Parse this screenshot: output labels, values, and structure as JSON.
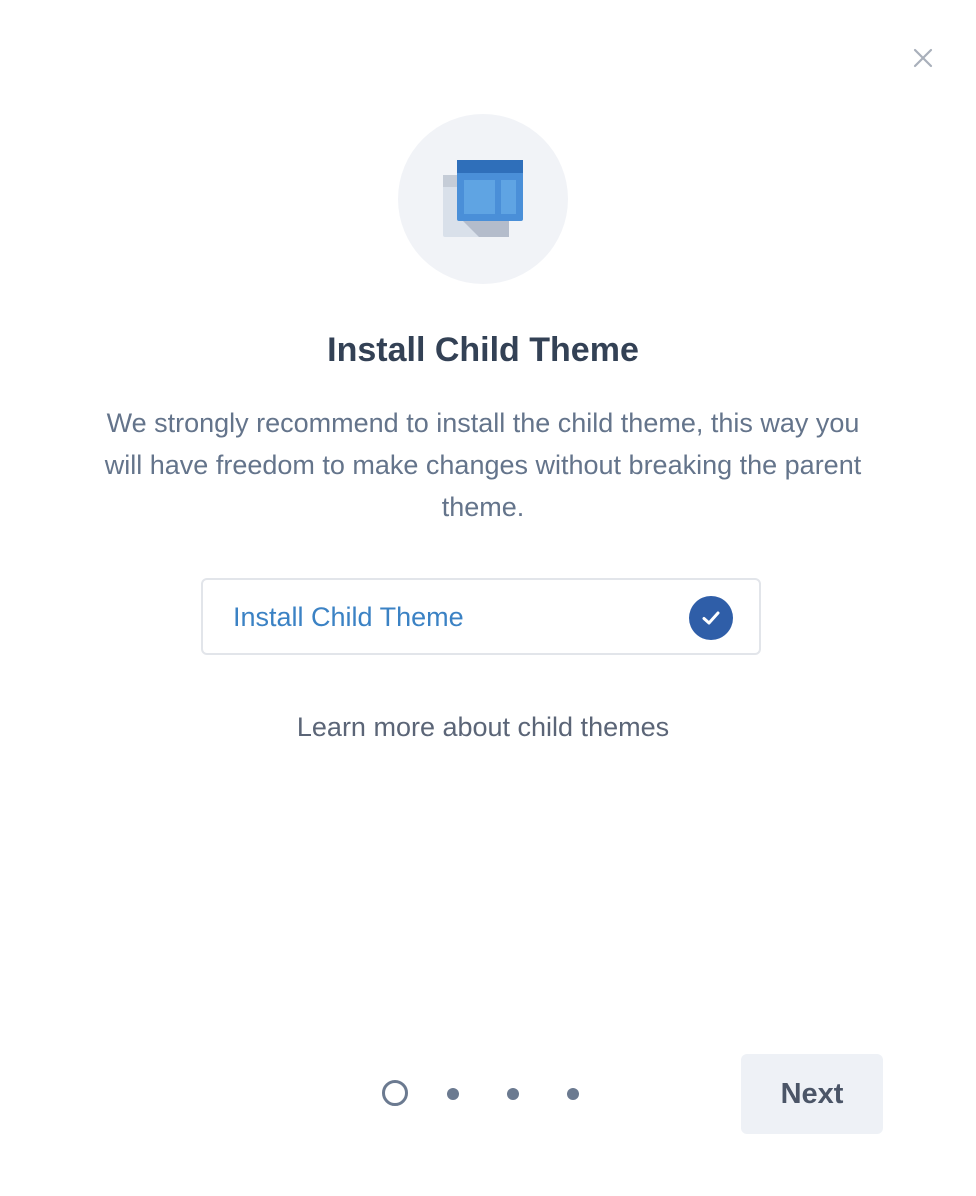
{
  "dialog": {
    "close_icon": "close-icon",
    "illustration_icon": "child-theme-layout-icon",
    "title": "Install Child Theme",
    "description": "We strongly recommend to install the child theme, this way you will have freedom to make changes without breaking the parent theme.",
    "install_option": {
      "label": "Install Child Theme",
      "checked": true,
      "check_icon": "checkmark-icon"
    },
    "learn_more_link": "Learn more about child themes",
    "pagination": {
      "total_steps": 4,
      "current_step": 1
    },
    "next_button": "Next"
  },
  "colors": {
    "accent_blue": "#3b82c4",
    "check_fill": "#2f5ea8",
    "title_text": "#334155",
    "body_text": "#64748b"
  }
}
